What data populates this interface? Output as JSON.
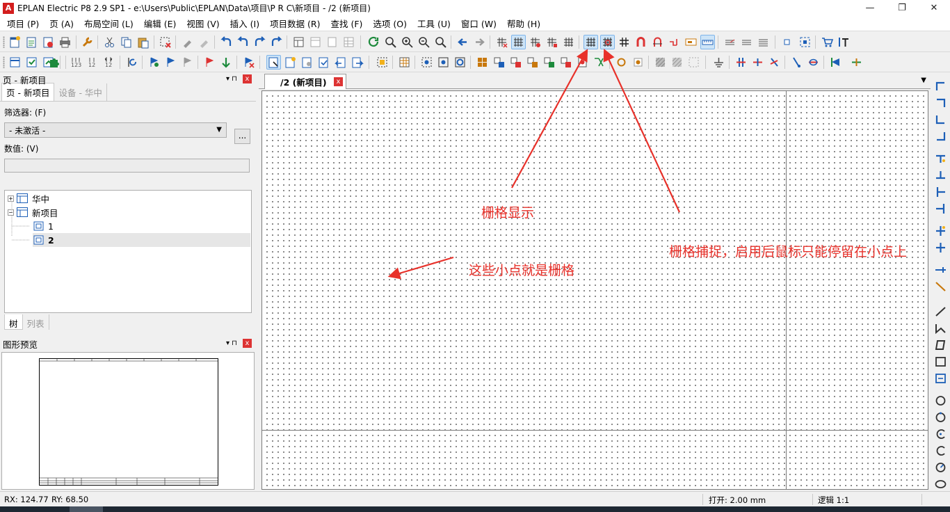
{
  "window": {
    "app_icon": "A",
    "title": "EPLAN Electric P8 2.9 SP1 - e:\\Users\\Public\\EPLAN\\Data\\项目\\P R C\\新项目 - /2 (新项目)",
    "minimize": "—",
    "maximize": "❐",
    "close": "✕"
  },
  "menu": [
    "项目 (P)",
    "页 (A)",
    "布局空间 (L)",
    "编辑 (E)",
    "视图 (V)",
    "插入 (I)",
    "项目数据 (R)",
    "查找 (F)",
    "选项 (O)",
    "工具 (U)",
    "窗口 (W)",
    "帮助 (H)"
  ],
  "page_navigator": {
    "title": "页 - 新项目",
    "pin": "▾  ⊓",
    "close": "x",
    "tab_active": "页 - 新项目",
    "tab_inactive": "设备 - 华中",
    "filter_label": "筛选器: (F)",
    "filter_value": "- 未激活 -",
    "filter_more": "...",
    "value_label": "数值: (V)",
    "tree": {
      "node_a": "华中",
      "node_b": "新项目",
      "page_1": "1",
      "page_2": "2",
      "collapsed": "+",
      "expanded": "−"
    },
    "bottom_tab_active": "树",
    "bottom_tab_inactive": "列表"
  },
  "graphic_preview": {
    "title": "图形预览"
  },
  "document_tab": {
    "label": "/2 (新项目)",
    "close": "x",
    "overflow": "▼"
  },
  "annotations": {
    "grid_display": "栅格显示",
    "grid_snap": "栅格捕捉，启用后鼠标只能停留在小点上",
    "dots_are_grid": "这些小点就是栅格"
  },
  "status": {
    "rx": "RX: 124.77",
    "ry": "RY: 68.50",
    "open": "打开: 2.00 mm",
    "logic": "逻辑 1:1"
  },
  "icons": {
    "grid_display_button": "grid-icon",
    "grid_snap_button": "grid-snap-icon"
  },
  "colors": {
    "annotation": "#e8312a",
    "active_toolbar": "#cde4f7"
  }
}
